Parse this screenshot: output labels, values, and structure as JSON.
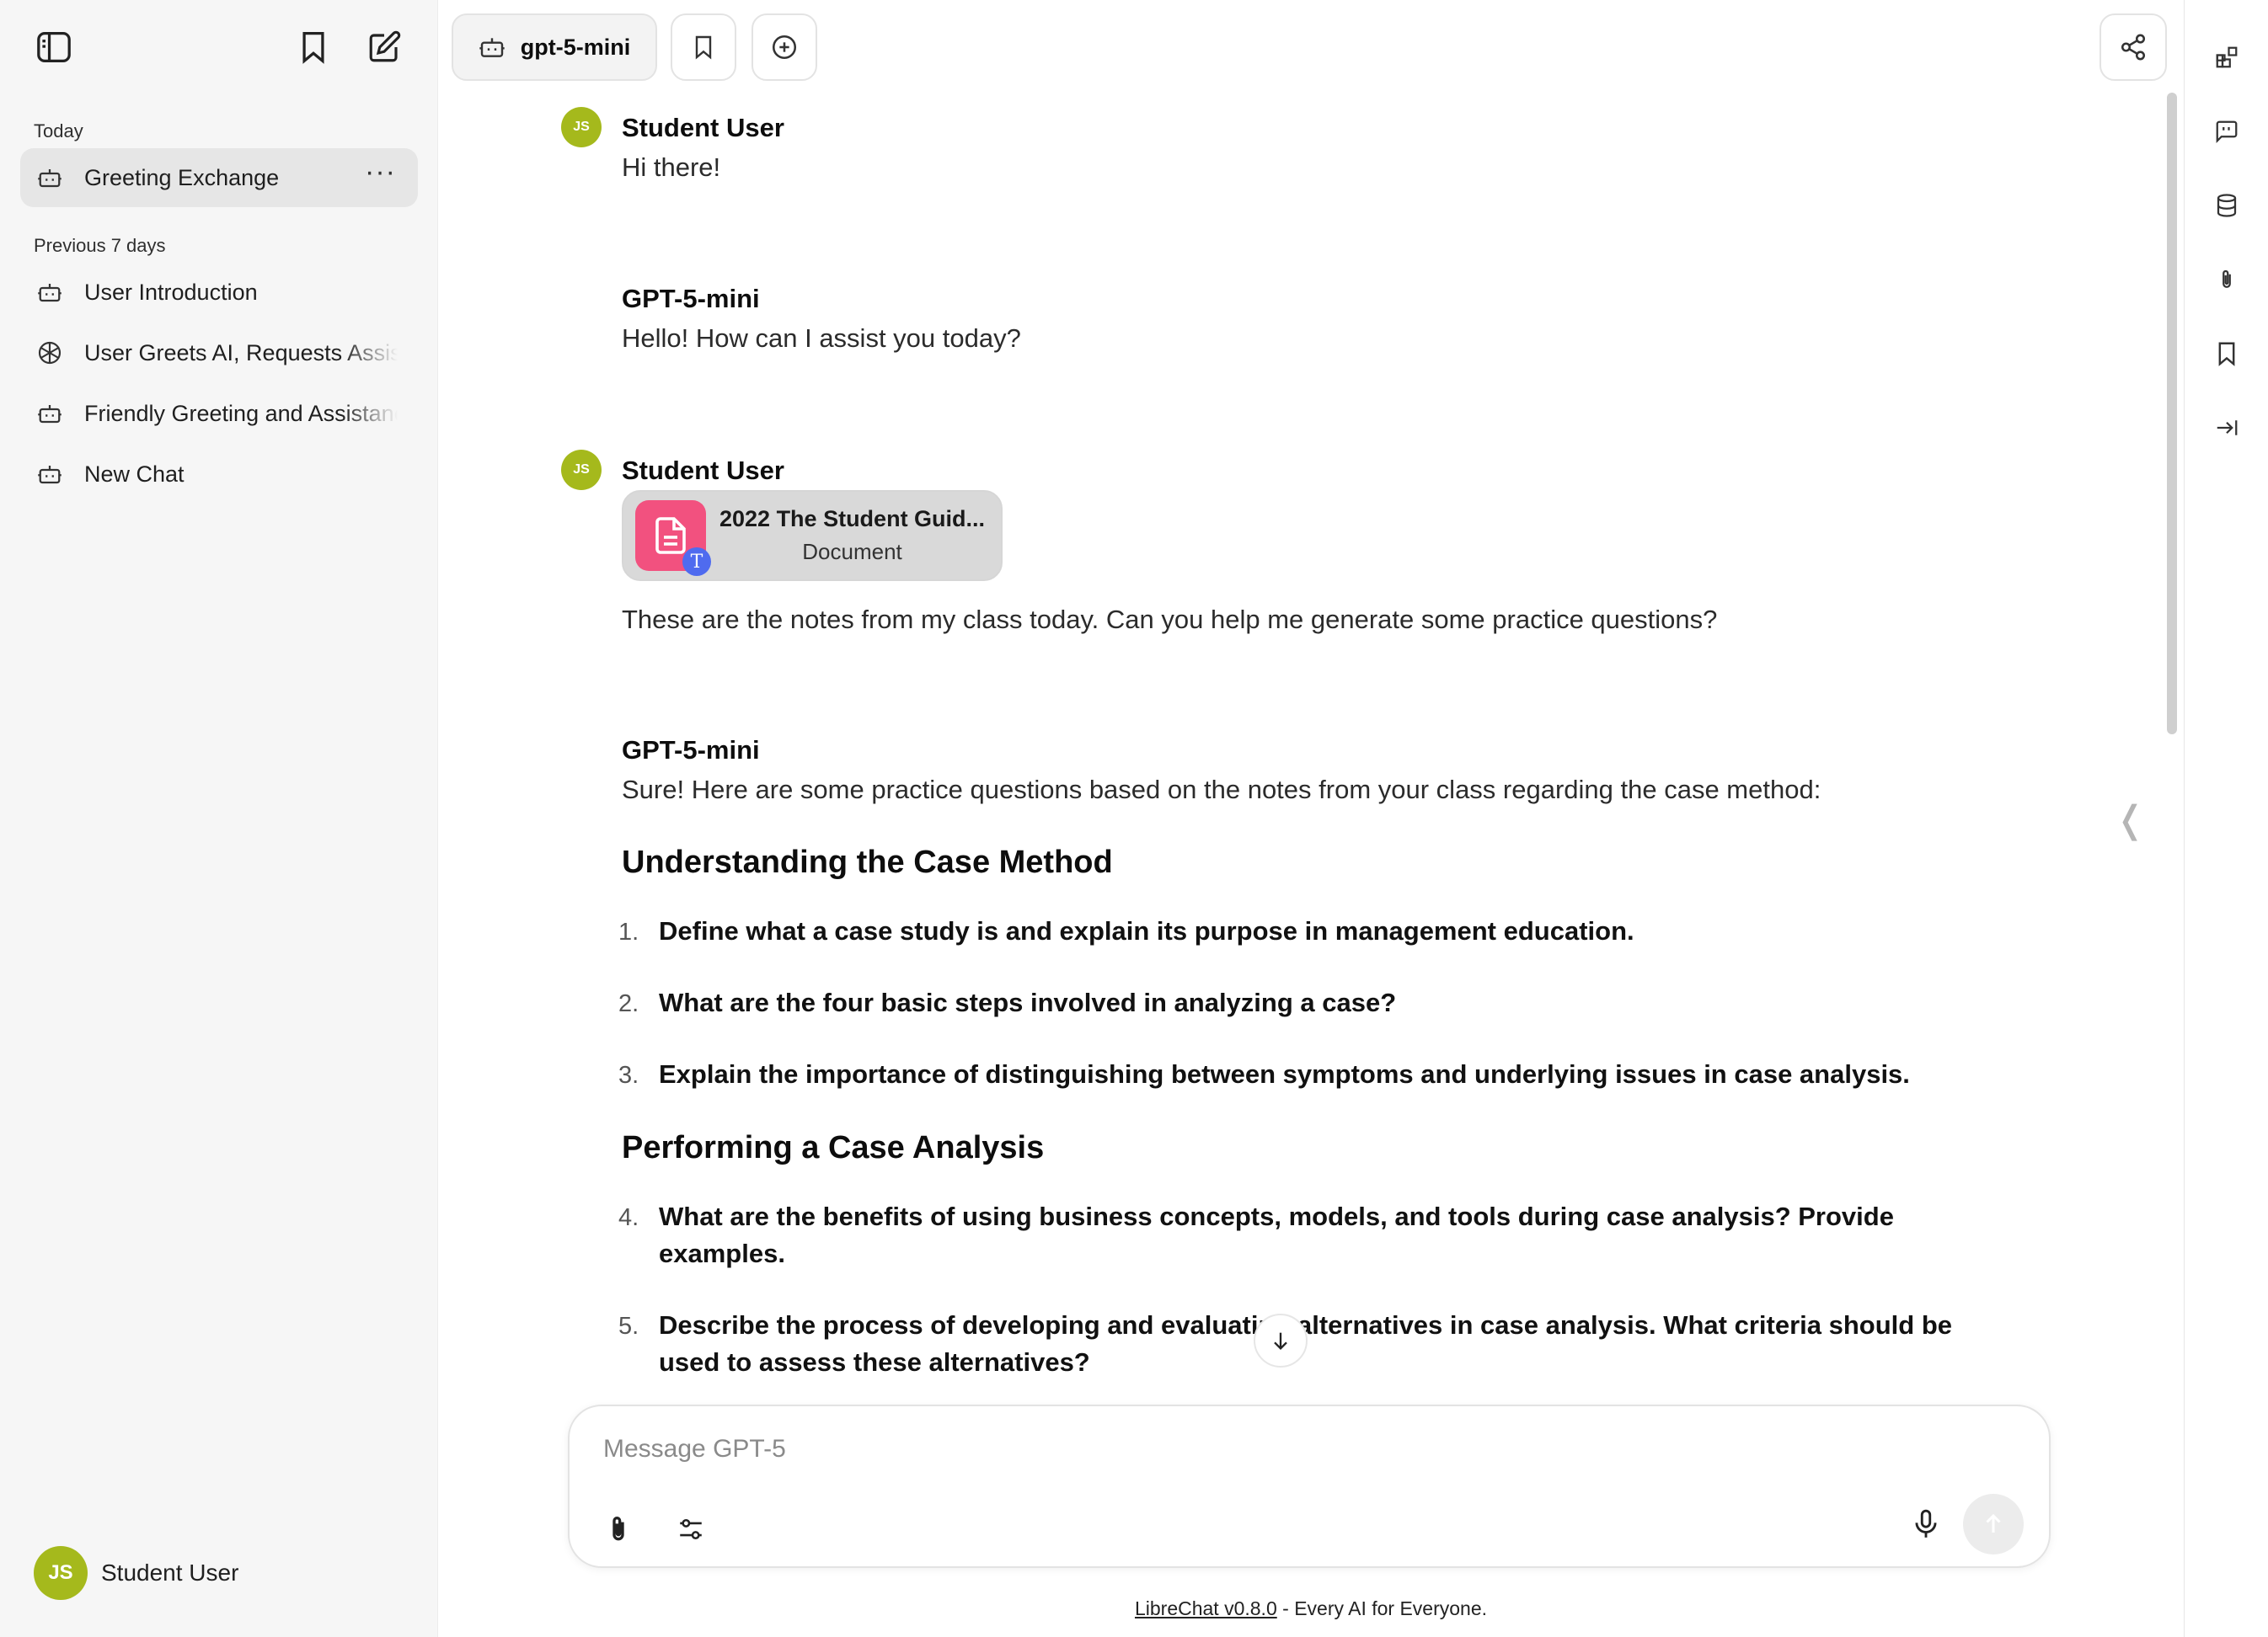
{
  "sidebar": {
    "sections": [
      {
        "label": "Today"
      },
      {
        "label": "Previous 7 days"
      }
    ],
    "items": [
      {
        "label": "Greeting Exchange",
        "icon": "bot-icon",
        "active": true
      },
      {
        "label": "User Introduction",
        "icon": "bot-icon"
      },
      {
        "label": "User Greets AI, Requests Assistance",
        "icon": "openai-icon"
      },
      {
        "label": "Friendly Greeting and Assistance",
        "icon": "bot-icon"
      },
      {
        "label": "New Chat",
        "icon": "bot-icon"
      }
    ],
    "user": {
      "initials": "JS",
      "name": "Student User"
    }
  },
  "topbar": {
    "model_label": "gpt-5-mini"
  },
  "messages": [
    {
      "author": "Student User",
      "avatar": "JS",
      "text": "Hi there!"
    },
    {
      "author": "GPT-5-mini",
      "text": "Hello! How can I assist you today?"
    },
    {
      "author": "Student User",
      "avatar": "JS",
      "file": {
        "name": "2022 The Student Guid...",
        "type": "Document",
        "badge": "T"
      },
      "text": "These are the notes from my class today. Can you help me generate some practice questions?"
    },
    {
      "author": "GPT-5-mini",
      "intro": "Sure! Here are some practice questions based on the notes from your class regarding the case method:",
      "sections": [
        {
          "heading": "Understanding the Case Method",
          "questions": [
            {
              "num": "1.",
              "text": "Define what a case study is and explain its purpose in management education."
            },
            {
              "num": "2.",
              "text": "What are the four basic steps involved in analyzing a case?"
            },
            {
              "num": "3.",
              "text": "Explain the importance of distinguishing between symptoms and underlying issues in case analysis."
            }
          ]
        },
        {
          "heading": "Performing a Case Analysis",
          "questions": [
            {
              "num": "4.",
              "text": "What are the benefits of using business concepts, models, and tools during case analysis? Provide examples."
            },
            {
              "num": "5.",
              "text": "Describe the process of developing and evaluating alternatives in case analysis. What criteria should be used to assess these alternatives?"
            }
          ]
        }
      ]
    }
  ],
  "composer": {
    "placeholder": "Message GPT-5"
  },
  "footer": {
    "link": "LibreChat v0.8.0",
    "text": " - Every AI for Everyone."
  },
  "colors": {
    "avatar": "#a5b91c",
    "file_icon": "#f2517f",
    "file_badge": "#4f6bef",
    "sidebar_bg": "#f6f6f6"
  }
}
